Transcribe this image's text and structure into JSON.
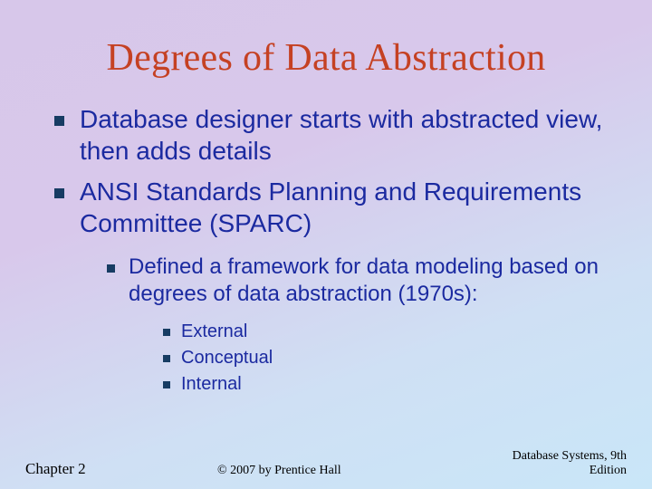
{
  "title": "Degrees of Data Abstraction",
  "bullets": {
    "item1": "Database designer starts with abstracted view, then adds details",
    "item2": "ANSI Standards Planning and Requirements Committee (SPARC)",
    "sub1": "Defined a framework for data modeling based on degrees of data abstraction (1970s):",
    "subsub": {
      "a": "External",
      "b": "Conceptual",
      "c": "Internal"
    }
  },
  "footer": {
    "left": "Chapter 2",
    "center": "© 2007 by Prentice Hall",
    "right_line1": "Database Systems, 9th",
    "right_line2": "Edition"
  }
}
